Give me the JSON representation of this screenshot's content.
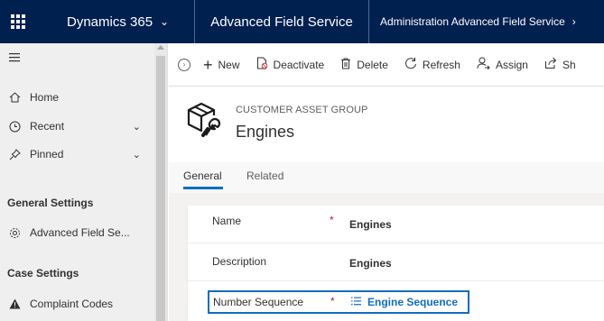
{
  "topbar": {
    "app_title": "Dynamics 365",
    "area_title": "Advanced Field Service",
    "area_subtitle": "Administration Advanced Field Service"
  },
  "sidebar": {
    "items": [
      {
        "label": "Home",
        "icon": "home-icon"
      },
      {
        "label": "Recent",
        "icon": "clock-icon"
      },
      {
        "label": "Pinned",
        "icon": "pin-icon"
      }
    ],
    "sections": [
      {
        "title": "General Settings",
        "items": [
          {
            "label": "Advanced Field Se...",
            "icon": "gear-icon"
          }
        ]
      },
      {
        "title": "Case Settings",
        "items": [
          {
            "label": "Complaint Codes",
            "icon": "warning-icon"
          }
        ]
      }
    ]
  },
  "commands": [
    {
      "label": "New",
      "icon": "plus-icon"
    },
    {
      "label": "Deactivate",
      "icon": "deactivate-icon"
    },
    {
      "label": "Delete",
      "icon": "trash-icon"
    },
    {
      "label": "Refresh",
      "icon": "refresh-icon"
    },
    {
      "label": "Assign",
      "icon": "assign-icon"
    },
    {
      "label": "Sh",
      "icon": "share-icon"
    }
  ],
  "header": {
    "entity_type": "CUSTOMER ASSET GROUP",
    "entity_name": "Engines"
  },
  "tabs": [
    {
      "label": "General",
      "active": true
    },
    {
      "label": "Related",
      "active": false
    }
  ],
  "form": {
    "fields": [
      {
        "label": "Name",
        "required": "*",
        "value": "Engines"
      },
      {
        "label": "Description",
        "value": "Engines"
      }
    ],
    "lookup": {
      "label": "Number Sequence",
      "required": "*",
      "value": "Engine Sequence"
    }
  },
  "colors": {
    "topbar": "#002050",
    "accent": "#106ebe",
    "required": "#a4262c"
  }
}
